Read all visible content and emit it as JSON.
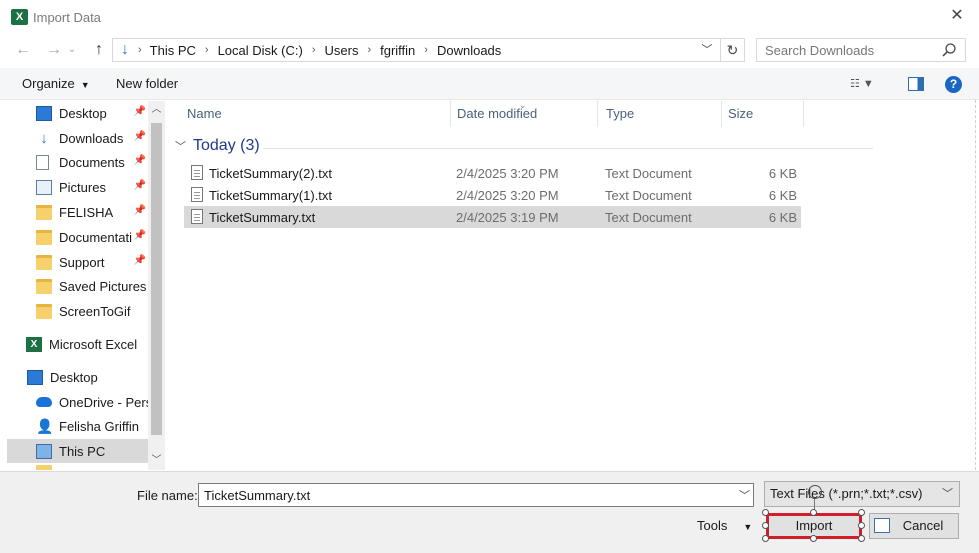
{
  "window": {
    "title": "Import Data",
    "app_icon": "excel-icon",
    "close": "✕"
  },
  "nav": {
    "back": "←",
    "forward": "→",
    "up": "↑",
    "breadcrumb": [
      "This PC",
      "Local Disk (C:)",
      "Users",
      "fgriffin",
      "Downloads"
    ],
    "search_placeholder": "Search Downloads"
  },
  "commands": {
    "organize": "Organize",
    "new_folder": "New folder"
  },
  "sidebar": {
    "items": [
      {
        "label": "Desktop",
        "icon": "desktop-icon",
        "pinned": true
      },
      {
        "label": "Downloads",
        "icon": "download-icon",
        "pinned": true
      },
      {
        "label": "Documents",
        "icon": "document-icon",
        "pinned": true
      },
      {
        "label": "Pictures",
        "icon": "pictures-icon",
        "pinned": true
      },
      {
        "label": "FELISHA",
        "icon": "folder-icon",
        "pinned": true
      },
      {
        "label": "Documentati",
        "icon": "folder-icon",
        "pinned": true
      },
      {
        "label": "Support",
        "icon": "folder-icon",
        "pinned": true
      },
      {
        "label": "Saved Pictures",
        "icon": "folder-icon",
        "pinned": false
      },
      {
        "label": "ScreenToGif",
        "icon": "folder-icon",
        "pinned": false
      },
      {
        "label": "Microsoft Excel",
        "icon": "excel-icon",
        "pinned": false
      },
      {
        "label": "Desktop",
        "icon": "desktop-icon",
        "pinned": false
      },
      {
        "label": "OneDrive - Persc",
        "icon": "cloud-icon",
        "pinned": false
      },
      {
        "label": "Felisha Griffin",
        "icon": "user-icon",
        "pinned": false
      },
      {
        "label": "This PC",
        "icon": "computer-icon",
        "pinned": false,
        "selected": true
      }
    ]
  },
  "columns": {
    "name": "Name",
    "date": "Date modified",
    "type": "Type",
    "size": "Size"
  },
  "group": {
    "label": "Today (3)"
  },
  "files": [
    {
      "name": "TicketSummary(2).txt",
      "date": "2/4/2025 3:20 PM",
      "type": "Text Document",
      "size": "6 KB"
    },
    {
      "name": "TicketSummary(1).txt",
      "date": "2/4/2025 3:20 PM",
      "type": "Text Document",
      "size": "6 KB"
    },
    {
      "name": "TicketSummary.txt",
      "date": "2/4/2025 3:19 PM",
      "type": "Text Document",
      "size": "6 KB",
      "selected": true
    }
  ],
  "footer": {
    "file_name_label": "File name:",
    "file_name_value": "TicketSummary.txt",
    "file_type": "Text Files (*.prn;*.txt;*.csv)",
    "tools": "Tools",
    "import": "Import",
    "cancel": "Cancel"
  },
  "colors": {
    "accent": "#1e3a8a",
    "highlight_border": "#d01f2a",
    "selection": "#d9d9d9"
  }
}
